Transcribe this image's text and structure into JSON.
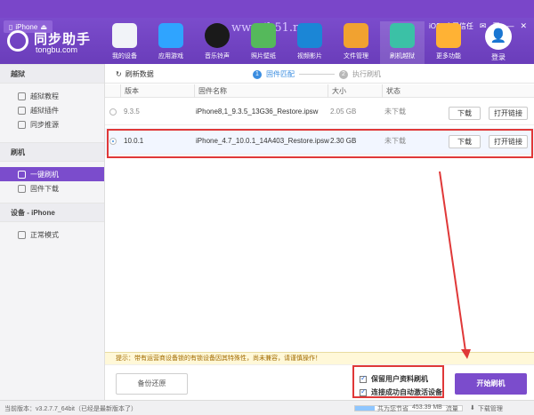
{
  "window": {
    "device_tab": "iPhone",
    "watermark": "www.jb51.net",
    "trust_label": "iOS9应用信任"
  },
  "brand": {
    "name": "同步助手",
    "domain": "tongbu.com"
  },
  "nav": {
    "items": [
      {
        "label": "我的设备",
        "color": "#f1f3f8",
        "icon": "phone-icon"
      },
      {
        "label": "应用游戏",
        "color": "#2fa4ff",
        "icon": "appstore-icon"
      },
      {
        "label": "音乐铃声",
        "color": "#1a1a1a",
        "icon": "music-icon"
      },
      {
        "label": "照片壁纸",
        "color": "#55b95b",
        "icon": "photo-icon"
      },
      {
        "label": "视频影片",
        "color": "#1b86d6",
        "icon": "video-icon"
      },
      {
        "label": "文件管理",
        "color": "#f1a230",
        "icon": "folder-icon"
      },
      {
        "label": "刷机越狱",
        "color": "#3bc1a6",
        "icon": "flash-icon"
      },
      {
        "label": "更多功能",
        "color": "#ffb234",
        "icon": "more-icon"
      }
    ],
    "login": "登录"
  },
  "sidebar": {
    "sections": [
      {
        "title": "越狱",
        "items": [
          {
            "label": "越狱教程",
            "active": false
          },
          {
            "label": "越狱插件",
            "active": false
          },
          {
            "label": "同步推源",
            "active": false
          }
        ]
      },
      {
        "title": "刷机",
        "items": [
          {
            "label": "一键刷机",
            "active": true
          },
          {
            "label": "固件下载",
            "active": false
          }
        ]
      },
      {
        "title": "设备 - iPhone",
        "items": [
          {
            "label": "正常模式",
            "active": false
          }
        ]
      }
    ]
  },
  "toolbar": {
    "refresh": "刷新数据"
  },
  "steps": [
    {
      "num": "1",
      "label": "固件匹配",
      "active": true
    },
    {
      "num": "2",
      "label": "执行刷机",
      "active": false
    }
  ],
  "table": {
    "headers": [
      "版本",
      "固件名称",
      "大小",
      "状态"
    ],
    "rows": [
      {
        "version": "9.3.5",
        "filename": "iPhone8,1_9.3.5_13G36_Restore.ipsw",
        "size": "2.05 GB",
        "status": "未下载",
        "download": "下载",
        "open_link": "打开链接",
        "selected": false
      },
      {
        "version": "10.0.1",
        "filename": "iPhone_4.7_10.0.1_14A403_Restore.ipsw",
        "size": "2.30 GB",
        "status": "未下载",
        "download": "下载",
        "open_link": "打开链接",
        "selected": true
      }
    ]
  },
  "notice": "提示：带有运营商设备锁的有锁设备因其特殊性，尚未兼容，请谨慎操作！",
  "actions": {
    "backup_restore": "备份还原",
    "keep_data": "保留用户资料刷机",
    "auto_activate": "连接成功自动激活设备",
    "start_flash": "开始刷机"
  },
  "statusbar": {
    "version": "当前版本：v3.2.7.7_64bit（已经是最新版本了）",
    "storage_label": "共为您节省",
    "storage_value": "453.39 MB",
    "storage_unit": "流量",
    "download_manager": "下载管理",
    "storage_fill": 0.18
  }
}
